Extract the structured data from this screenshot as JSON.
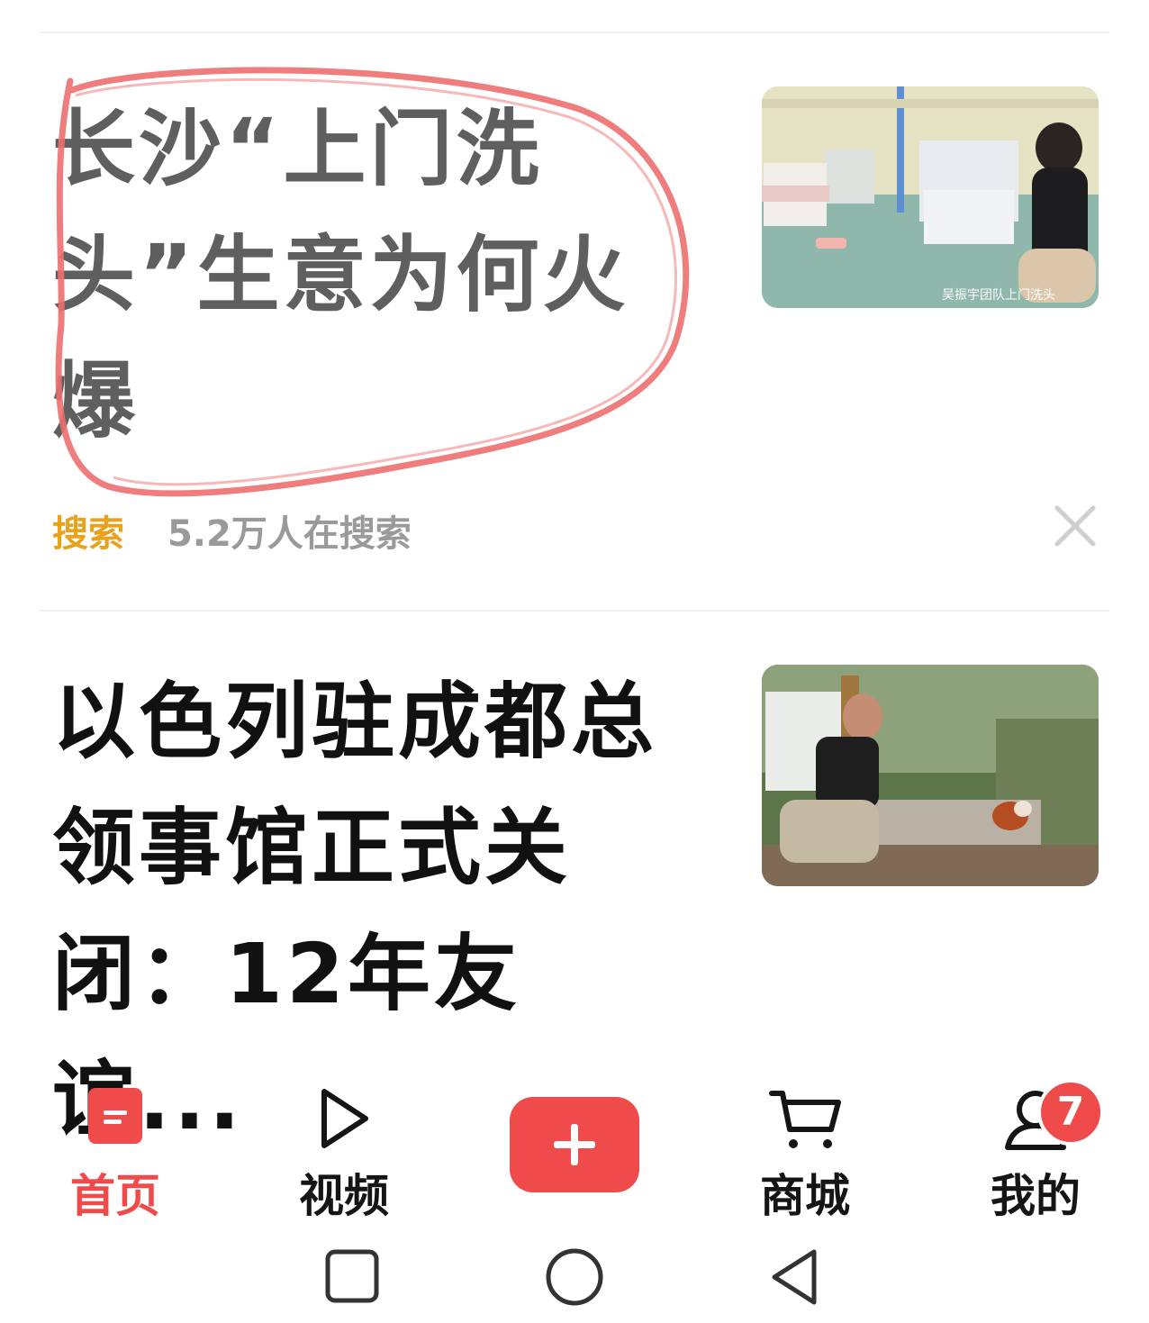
{
  "feed": {
    "items": [
      {
        "title": "长沙“上门洗头”生意为何火爆",
        "thumbnail_caption": "吴振宇团队上门洗头",
        "meta_tag": "搜索",
        "meta_count": "5.2万人在搜索"
      },
      {
        "title": "以色列驻成都总领事馆正式关闭：12年友谊..."
      }
    ]
  },
  "tabbar": {
    "tabs": [
      {
        "label": "首页",
        "icon": "home-news-icon",
        "active": true
      },
      {
        "label": "视频",
        "icon": "play-icon"
      },
      {
        "label": "",
        "icon": "plus-icon"
      },
      {
        "label": "商城",
        "icon": "cart-icon"
      },
      {
        "label": "我的",
        "icon": "profile-icon"
      }
    ],
    "profile_badge": "7",
    "accent_color": "#f04b4b"
  },
  "system_nav": {
    "buttons": [
      "recents-icon",
      "home-icon",
      "back-icon"
    ]
  }
}
